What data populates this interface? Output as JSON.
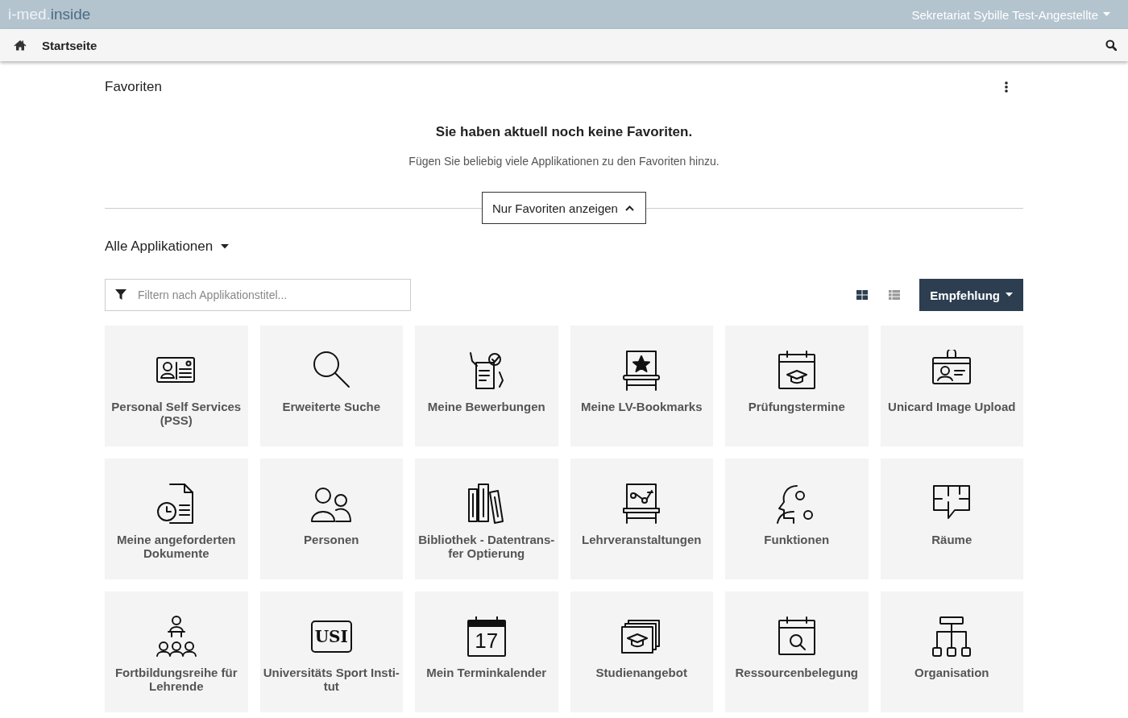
{
  "header": {
    "logo_prefix": "i-med.",
    "logo_suffix": "inside",
    "user": "Sekretariat Sybille Test-Angestellte"
  },
  "nav": {
    "title": "Startseite"
  },
  "favorites": {
    "title": "Favoriten",
    "empty_title": "Sie haben aktuell noch keine Favoriten.",
    "empty_hint": "Fügen Sie beliebig viele Applikationen zu den Favoriten hinzu.",
    "toggle": "Nur Favoriten anzeigen"
  },
  "apps": {
    "title": "Alle Applikationen",
    "filter_placeholder": "Filtern nach Applikationstitel...",
    "view_options": [
      {
        "kind": "grid",
        "selected": true
      },
      {
        "kind": "list",
        "selected": false
      }
    ],
    "sort": "Empfehlung",
    "tiles": [
      {
        "lines": [
          "Personal Self Services",
          "(PSS)"
        ],
        "kind": "idcard"
      },
      {
        "lines": [
          "Erweiterte Suche"
        ],
        "kind": "magnifier"
      },
      {
        "lines": [
          "Meine Bewerbungen"
        ],
        "kind": "application"
      },
      {
        "lines": [
          "Meine LV-Bookmarks"
        ],
        "kind": "bookmark"
      },
      {
        "lines": [
          "Prüfungstermine"
        ],
        "kind": "exam"
      },
      {
        "lines": [
          "Unicard Image Upload"
        ],
        "kind": "badge"
      },
      {
        "lines": [
          "Meine angeforderten",
          "Dokumente"
        ],
        "kind": "document"
      },
      {
        "lines": [
          "Personen"
        ],
        "kind": "people"
      },
      {
        "lines": [
          "Bibliothek - Datentrans-",
          "fer Optierung"
        ],
        "kind": "books"
      },
      {
        "lines": [
          "Lehrveranstaltungen"
        ],
        "kind": "board"
      },
      {
        "lines": [
          "Funktionen"
        ],
        "kind": "functions"
      },
      {
        "lines": [
          "Räume"
        ],
        "kind": "rooms"
      },
      {
        "lines": [
          "Fortbildungsreihe für",
          "Lehrende"
        ],
        "kind": "training"
      },
      {
        "lines": [
          "Universitäts Sport Insti-",
          "tut"
        ],
        "kind": "logo",
        "icon_text": "USI"
      },
      {
        "lines": [
          "Mein Terminkalender"
        ],
        "kind": "calendar",
        "icon_text": "17"
      },
      {
        "lines": [
          "Studienangebot"
        ],
        "kind": "studies"
      },
      {
        "lines": [
          "Ressourcenbelegung"
        ],
        "kind": "resource"
      },
      {
        "lines": [
          "Organisation"
        ],
        "kind": "orgchart"
      }
    ]
  }
}
